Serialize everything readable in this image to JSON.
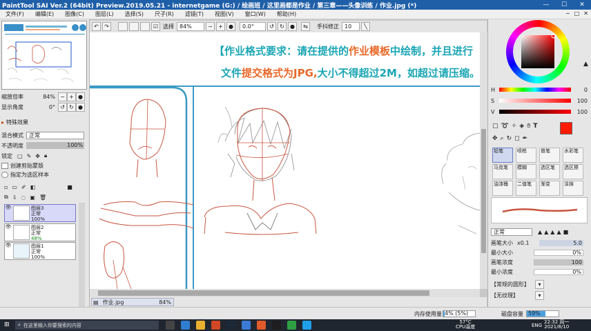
{
  "window": {
    "title": "PaintTool SAI Ver.2 (64bit) Preview.2019.05.21 - internetgame (G:) / 绘画班 / 这里画都是作业 / 第三章——头像训练 / 作业.jpg (*)",
    "controls": [
      "—",
      "☐",
      "✕"
    ]
  },
  "menu": {
    "items": [
      "文件(F)",
      "编辑(E)",
      "图像(C)",
      "图层(L)",
      "选择(S)",
      "尺子(R)",
      "滤镜(T)",
      "视图(V)",
      "窗口(W)",
      "帮助(H)"
    ],
    "right_icons": [
      "−",
      "□",
      "✕"
    ]
  },
  "toolbar": {
    "selection_label": "选择",
    "zoom": "84%",
    "angle": "0.0°",
    "stabilizer_label": "手抖修正",
    "stabilizer_value": "10"
  },
  "left": {
    "zoom_label": "缩放倍率",
    "zoom_value": "84%",
    "angle_label": "显示角度",
    "angle_value": "0°",
    "effects_label": "特殊效果",
    "blend_label": "混合模式",
    "blend_value": "正常",
    "opacity_label": "不透明度",
    "opacity_value": "100%",
    "lock_label": "锁定",
    "clip_label": "创建剪贴蒙版",
    "sample_label": "指定为选区样本",
    "layers": [
      {
        "name": "图层3",
        "mode": "正常",
        "opacity": "100%",
        "selected": true
      },
      {
        "name": "图层2",
        "mode": "正常",
        "opacity": "48%",
        "selected": false
      },
      {
        "name": "图层1",
        "mode": "正常",
        "opacity": "100%",
        "selected": false
      }
    ]
  },
  "canvas": {
    "instruction_line1_a": "【作业格式要求：请在提供的",
    "instruction_line1_b": "作业模板",
    "instruction_line1_c": "中绘制，并且进行",
    "instruction_line2_a": "文件",
    "instruction_line2_b": "提交格式为JPG,",
    "instruction_line2_c": "大小不得超过2M，如超过请压缩。"
  },
  "right": {
    "h_label": "H",
    "h_value": "0",
    "s_label": "S",
    "s_value": "100",
    "v_label": "V",
    "v_value": "100",
    "brushes": [
      "铅笔",
      "喷枪",
      "普笔",
      "水彩笔",
      "马克笔",
      "模糊",
      "选区笔",
      "选区擦",
      "油漆桶",
      "二值笔",
      "渐变",
      "涂抹"
    ],
    "blend_mode": "正常",
    "brush_size_label": "画笔大小",
    "brush_size_mult": "x0.1",
    "brush_size_value": "5.0",
    "min_size_label": "最小大小",
    "min_size_value": "0%",
    "density_label": "画笔浓度",
    "density_value": "100",
    "min_density_label": "最小浓度",
    "min_density_value": "0%",
    "shape_label": "【常规的圆形】",
    "texture_label": "【无纹理】"
  },
  "status": {
    "file_name": "作业.jpg",
    "file_zoom": "84%",
    "memory_label": "内存使用量",
    "memory_value": "4% (5%)",
    "memory_percent": 4,
    "disk_label": "磁盘容量",
    "disk_value": "59%",
    "disk_percent": 59
  },
  "taskbar": {
    "search_placeholder": "在这里输入你要搜索的内容",
    "temp": "57°C",
    "temp_label": "CPU温度",
    "lang": "ENG",
    "time": "22:32 周一",
    "date": "2021/8/10"
  },
  "colors": {
    "accent": "#1f5fa8",
    "current_color": "#ff1a00",
    "instruction_teal": "#1ba6b4",
    "instruction_orange": "#e8692a",
    "sketch_red": "#c8553f"
  }
}
